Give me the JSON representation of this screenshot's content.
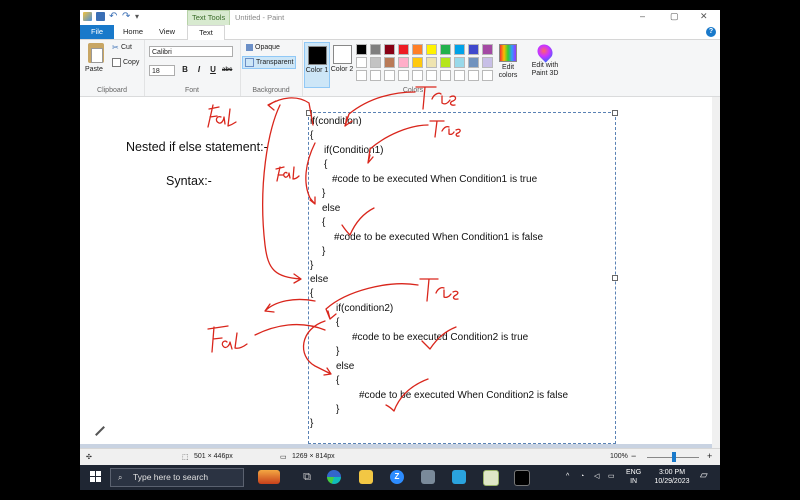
{
  "window": {
    "title": "Untitled - Paint",
    "context_tab": "Text Tools",
    "controls": {
      "minimize": "–",
      "maximize": "▢",
      "close": "✕"
    },
    "help": "?"
  },
  "tabs": [
    {
      "label": "File"
    },
    {
      "label": "Home"
    },
    {
      "label": "View"
    },
    {
      "label": "Text"
    }
  ],
  "ribbon": {
    "clipboard": {
      "paste": "Paste",
      "cut": "Cut",
      "copy": "Copy",
      "group": "Clipboard"
    },
    "font": {
      "name": "Calibri",
      "size": "18",
      "bold": "B",
      "italic": "I",
      "underline": "U",
      "strike": "abc",
      "group": "Font"
    },
    "background": {
      "opaque": "Opaque",
      "transparent": "Transparent",
      "group": "Background"
    },
    "colors": {
      "color1": "Color 1",
      "color2": "Color 2",
      "edit": "Edit colors",
      "group": "Colors",
      "palette": [
        "#000000",
        "#7f7f7f",
        "#880015",
        "#ed1c24",
        "#ff7f27",
        "#fff200",
        "#22b14c",
        "#00a2e8",
        "#3f48cc",
        "#a349a4",
        "#ffffff",
        "#c3c3c3",
        "#b97a57",
        "#ffaec9",
        "#ffc90e",
        "#efe4b0",
        "#b5e61d",
        "#99d9ea",
        "#7092be",
        "#c8bfe7",
        "#ffffff",
        "#ffffff",
        "#ffffff",
        "#ffffff",
        "#ffffff",
        "#ffffff",
        "#ffffff",
        "#ffffff",
        "#ffffff",
        "#ffffff"
      ],
      "color1_value": "#000000",
      "color2_value": "#ffffff"
    },
    "paint3d": "Edit with Paint 3D"
  },
  "canvas": {
    "heading": "Nested if else statement:-",
    "syntax": "Syntax:-",
    "code": [
      "if(condition)",
      "{",
      "if(Condition1)",
      "{",
      "#code to be executed When Condition1 is true",
      "}",
      "else",
      "{",
      "#code to be executed When Condition1 is false",
      "}",
      "}",
      "else",
      "{",
      "if(condition2)",
      "{",
      "#code to be executed Condition2 is true",
      "}",
      "else",
      "{",
      "#code to be executed When Condition2 is false",
      "}",
      "}"
    ],
    "annotations": {
      "false_label": "False",
      "true_label": "True",
      "ink_color": "#d9261c"
    }
  },
  "status": {
    "selection_size": "501 × 446px",
    "image_size": "1269 × 814px",
    "zoom": "100%",
    "zoom_out": "−",
    "zoom_in": "+"
  },
  "taskbar": {
    "search_placeholder": "Type here to search",
    "lang": "ENG",
    "region": "IN",
    "time": "3:00 PM",
    "date": "10/29/2023"
  }
}
